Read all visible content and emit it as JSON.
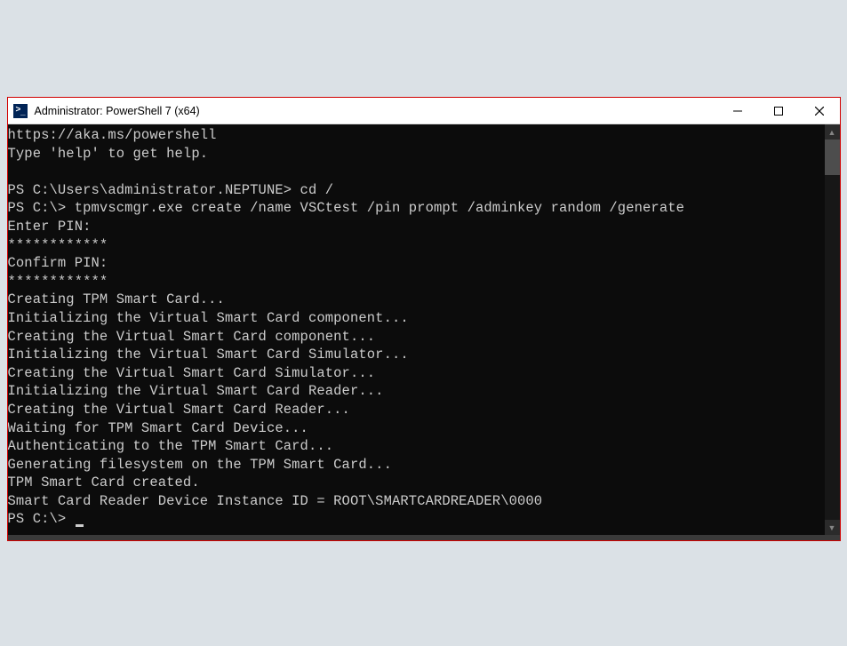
{
  "window": {
    "title": "Administrator: PowerShell 7 (x64)"
  },
  "console": {
    "lines": [
      "https://aka.ms/powershell",
      "Type 'help' to get help.",
      "",
      "PS C:\\Users\\administrator.NEPTUNE> cd /",
      "PS C:\\> tpmvscmgr.exe create /name VSCtest /pin prompt /adminkey random /generate",
      "Enter PIN:",
      "************",
      "Confirm PIN:",
      "************",
      "Creating TPM Smart Card...",
      "Initializing the Virtual Smart Card component...",
      "Creating the Virtual Smart Card component...",
      "Initializing the Virtual Smart Card Simulator...",
      "Creating the Virtual Smart Card Simulator...",
      "Initializing the Virtual Smart Card Reader...",
      "Creating the Virtual Smart Card Reader...",
      "Waiting for TPM Smart Card Device...",
      "Authenticating to the TPM Smart Card...",
      "Generating filesystem on the TPM Smart Card...",
      "TPM Smart Card created.",
      "Smart Card Reader Device Instance ID = ROOT\\SMARTCARDREADER\\0000",
      "PS C:\\> "
    ]
  }
}
